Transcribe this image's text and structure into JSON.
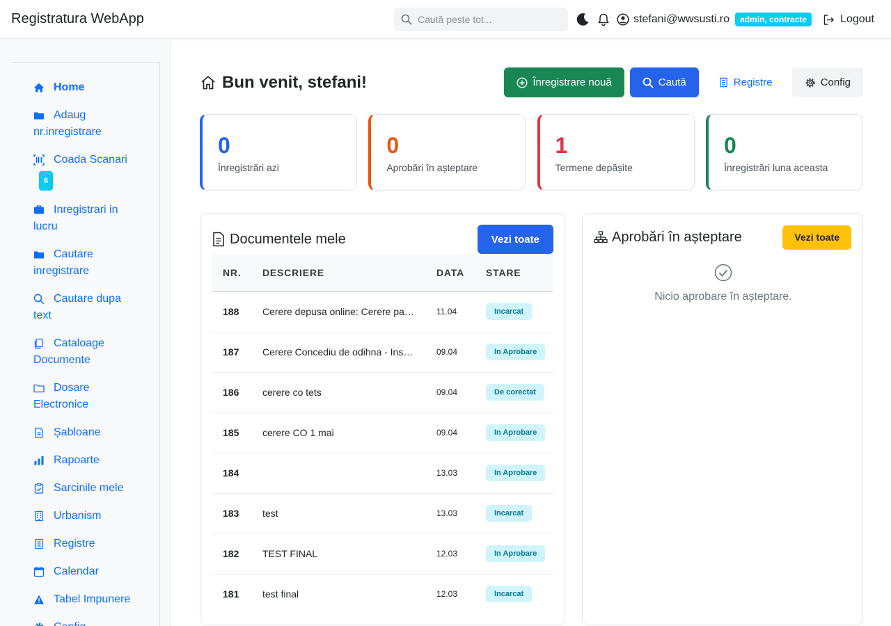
{
  "app": {
    "title": "Registratura WebApp"
  },
  "header": {
    "search_placeholder": "Caută peste tot...",
    "user_email": "stefani@wwsusti.ro",
    "role_badge": "admin, contracte",
    "logout_label": "Logout"
  },
  "sidebar": {
    "items": [
      {
        "label": "Home",
        "icon": "home-icon"
      },
      {
        "label": "Adaug nr.inregistrare",
        "icon": "folder-icon"
      },
      {
        "label": "Coada Scanari",
        "icon": "barcode-icon",
        "badge": "6"
      },
      {
        "label": "Inregistrari in lucru",
        "icon": "briefcase-icon"
      },
      {
        "label": "Cautare inregistrare",
        "icon": "folder-icon"
      },
      {
        "label": "Cautare dupa text",
        "icon": "search-icon"
      },
      {
        "label": "Cataloage Documente",
        "icon": "copy-icon"
      },
      {
        "label": "Dosare Electronice",
        "icon": "folder-open-icon"
      },
      {
        "label": "Șabloane",
        "icon": "file-icon"
      },
      {
        "label": "Rapoarte",
        "icon": "bar-chart-icon"
      },
      {
        "label": "Sarcinile mele",
        "icon": "clipboard-icon"
      },
      {
        "label": "Urbanism",
        "icon": "building-icon"
      },
      {
        "label": "Registre",
        "icon": "journal-icon"
      },
      {
        "label": "Calendar",
        "icon": "calendar-icon"
      },
      {
        "label": "Tabel Impunere",
        "icon": "warning-icon"
      },
      {
        "label": "Config",
        "icon": "gear-icon"
      }
    ]
  },
  "main": {
    "welcome": "Bun venit, stefani!",
    "actions": {
      "new_reg": "Înregistrare nouă",
      "search": "Caută",
      "registers": "Registre",
      "config": "Config"
    },
    "stats": [
      {
        "value": "0",
        "label": "Înregistrări azi",
        "color": "#2563eb"
      },
      {
        "value": "0",
        "label": "Aprobări în așteptare",
        "color": "#e8590c"
      },
      {
        "value": "1",
        "label": "Termene depășite",
        "color": "#dc3545"
      },
      {
        "value": "0",
        "label": "Înregistrări luna aceasta",
        "color": "#198754"
      }
    ],
    "docs": {
      "title": "Documentele mele",
      "view_all": "Vezi toate",
      "columns": {
        "nr": "NR.",
        "desc": "DESCRIERE",
        "date": "DATA",
        "status": "STARE"
      },
      "rows": [
        {
          "nr": "188",
          "desc": "Cerere depusa online: Cerere pare...",
          "date": "11.04",
          "status": "Incarcat"
        },
        {
          "nr": "187",
          "desc": "Cerere Concediu de odihna - Insuf...",
          "date": "09.04",
          "status": "In Aprobare"
        },
        {
          "nr": "186",
          "desc": "cerere co tets",
          "date": "09.04",
          "status": "De corectat"
        },
        {
          "nr": "185",
          "desc": "cerere CO 1 mai",
          "date": "09.04",
          "status": "In Aprobare"
        },
        {
          "nr": "184",
          "desc": "",
          "date": "13.03",
          "status": "In Aprobare"
        },
        {
          "nr": "183",
          "desc": "test",
          "date": "13.03",
          "status": "Incarcat"
        },
        {
          "nr": "182",
          "desc": "TEST FINAL",
          "date": "12.03",
          "status": "In Aprobare"
        },
        {
          "nr": "181",
          "desc": "test final",
          "date": "12.03",
          "status": "Incarcat"
        }
      ]
    },
    "approvals": {
      "title": "Aprobări în așteptare",
      "view_all": "Vezi toate",
      "empty_text": "Nicio aprobare în așteptare."
    }
  }
}
